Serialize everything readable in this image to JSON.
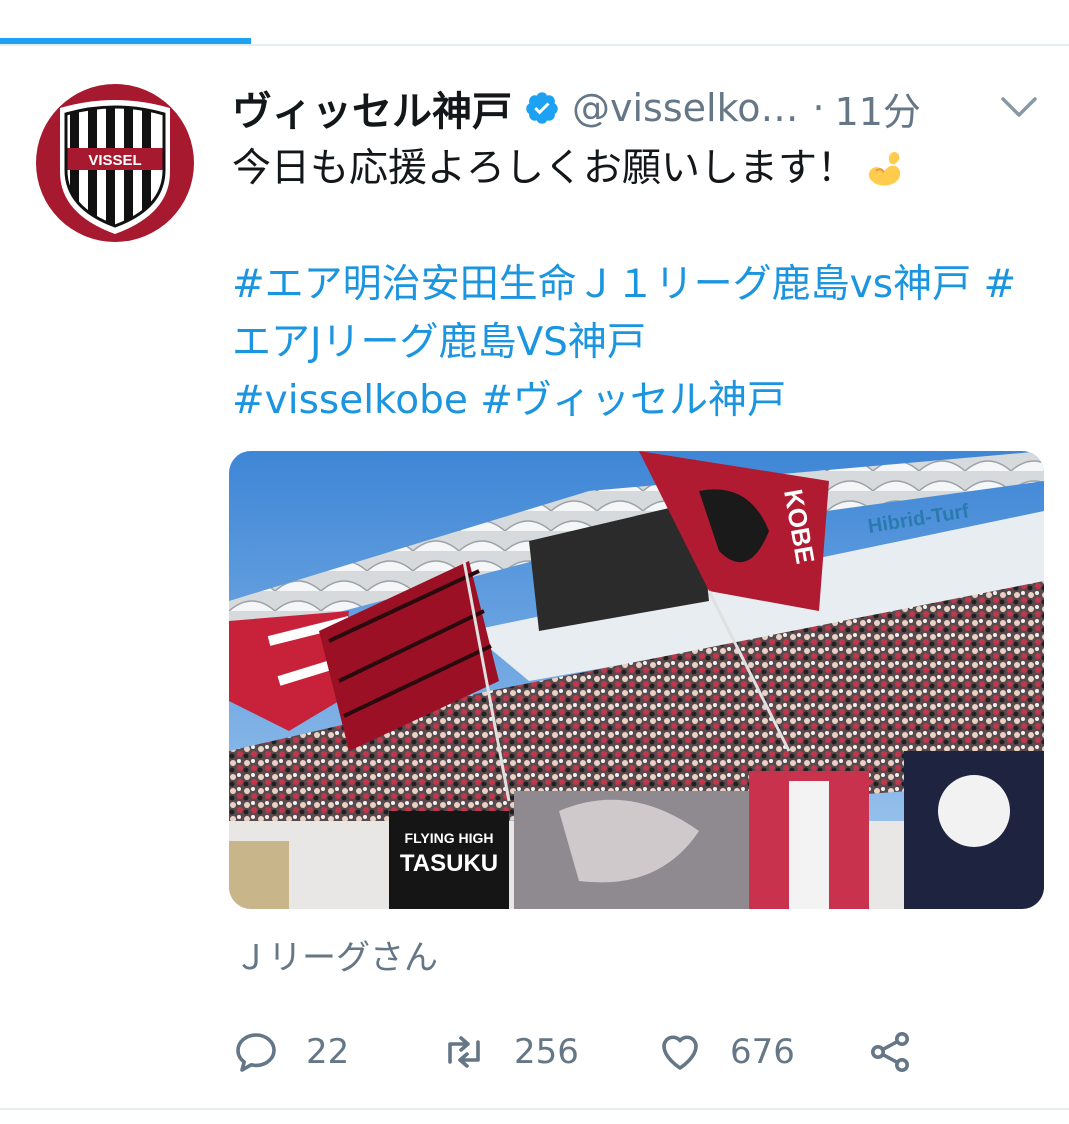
{
  "progress_fraction": 0.235,
  "tweet": {
    "display_name": "ヴィッセル神戸",
    "handle": "@visselko…",
    "separator": "·",
    "time": "11分",
    "verified": true,
    "avatar_logo_text": "VISSEL",
    "text_line": "今日も応援よろしくお願いします！",
    "emoji_name": "flexed-biceps-emoji",
    "hashtags": [
      "#エア明治安田生命Ｊ１リーグ鹿島vs神戸",
      "#エアJリーグ鹿島VS神戸",
      "#visselkobe",
      "#ヴィッセル神戸"
    ],
    "media_caption": "Ｊリーグさん",
    "image_alt": "stadium-crowd-flags-photo",
    "image_banners": [
      "Hibrid-Turf",
      "KOBE",
      "FLYING HIGH",
      "TASUKU"
    ]
  },
  "actions": {
    "reply_count": "22",
    "retweet_count": "256",
    "like_count": "676"
  },
  "colors": {
    "link": "#1b95e0",
    "muted": "#657786",
    "brand_red": "#a6192e",
    "progress": "#1da1f2"
  },
  "icons": [
    "reply-icon",
    "retweet-icon",
    "like-icon",
    "share-icon",
    "chevron-down-icon",
    "verified-badge-icon"
  ]
}
